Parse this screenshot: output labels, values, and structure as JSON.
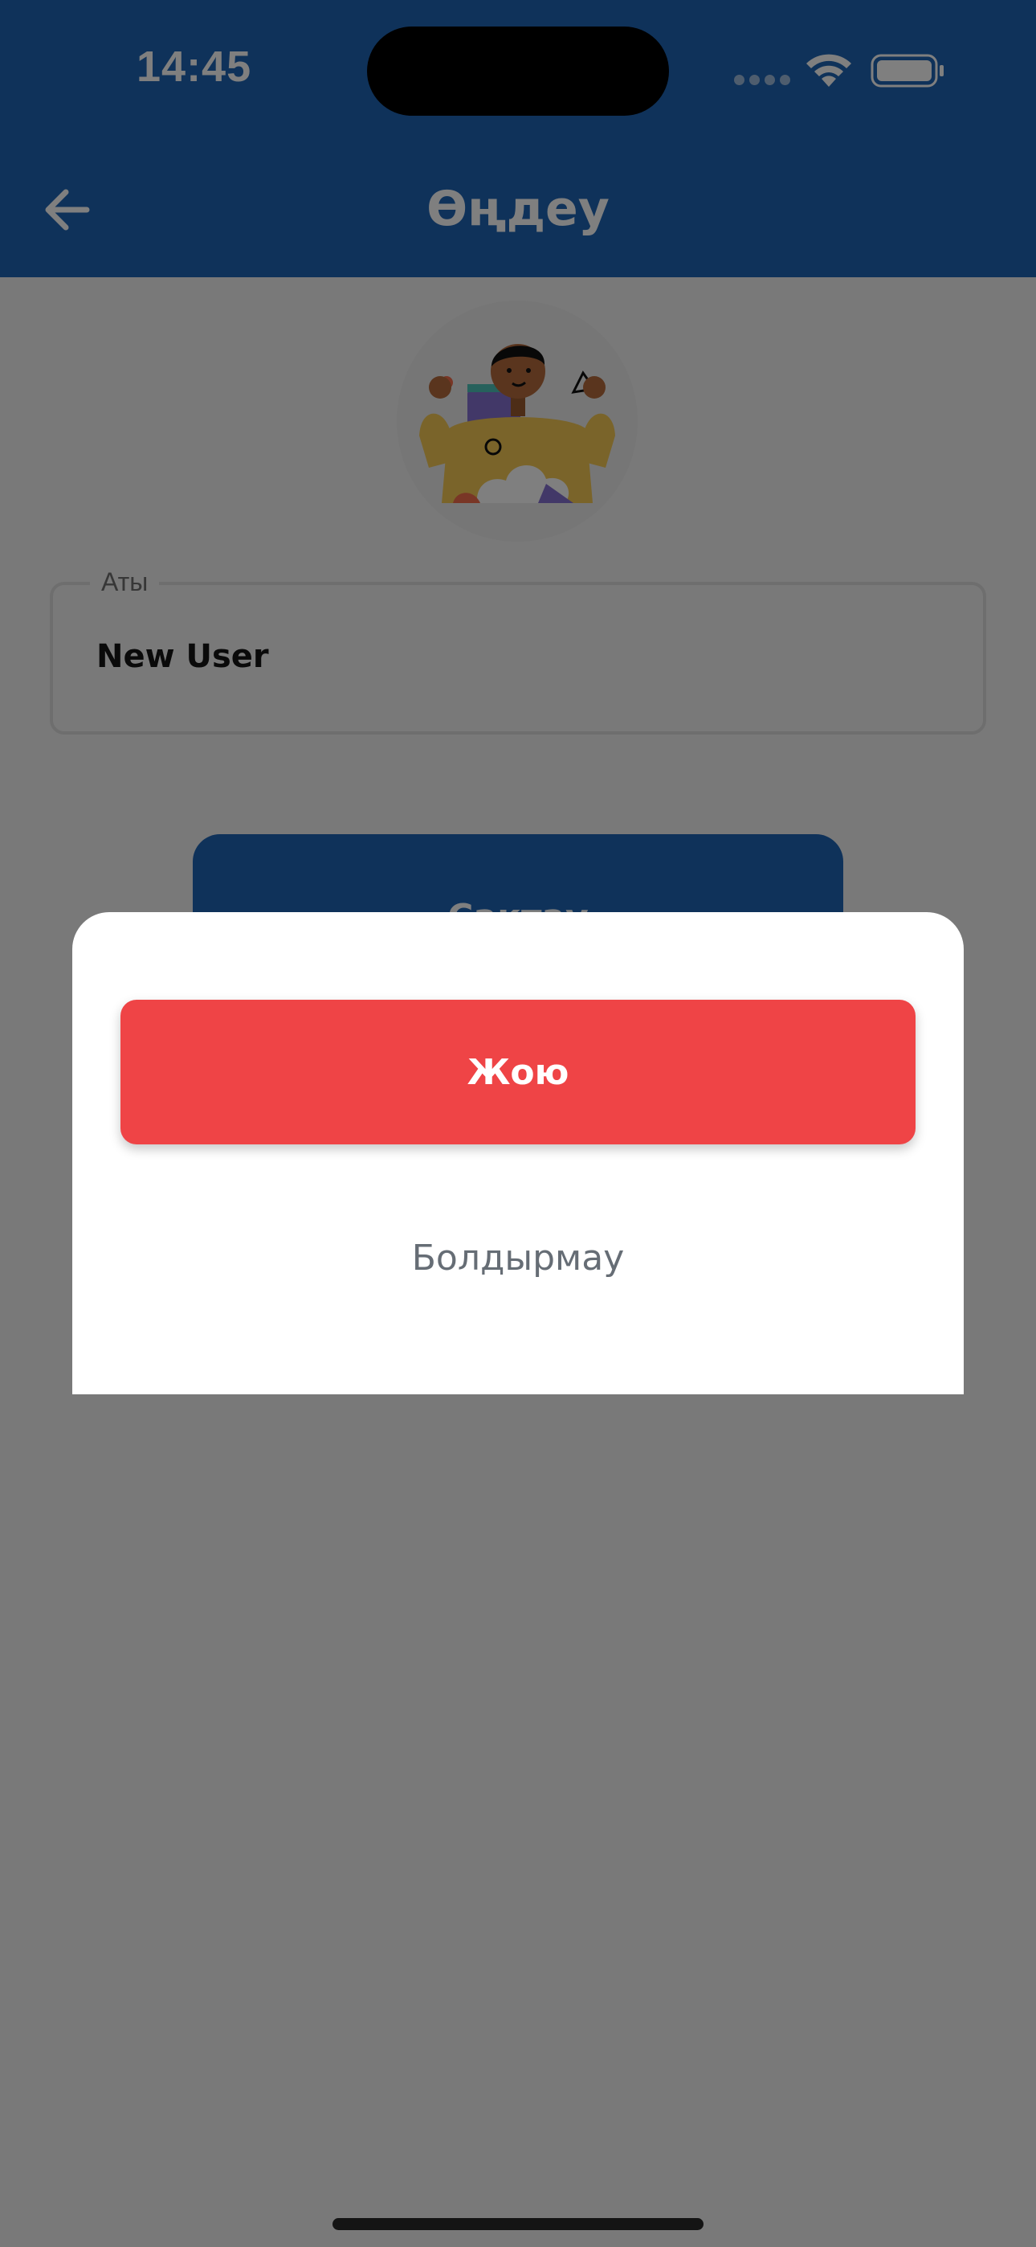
{
  "status_bar": {
    "time": "14:45"
  },
  "header": {
    "title": "Өңдеу",
    "back_icon": "arrow-left-icon"
  },
  "profile": {
    "avatar_icon": "person-illustration"
  },
  "form": {
    "name_label": "Аты",
    "name_value": "New User",
    "save_label": "Сақтау"
  },
  "dialog": {
    "delete_label": "Жою",
    "cancel_label": "Болдырмау"
  },
  "colors": {
    "primary": "#1e64b4",
    "danger": "#ef4446",
    "scrim": "rgba(0,0,0,0.5)"
  }
}
